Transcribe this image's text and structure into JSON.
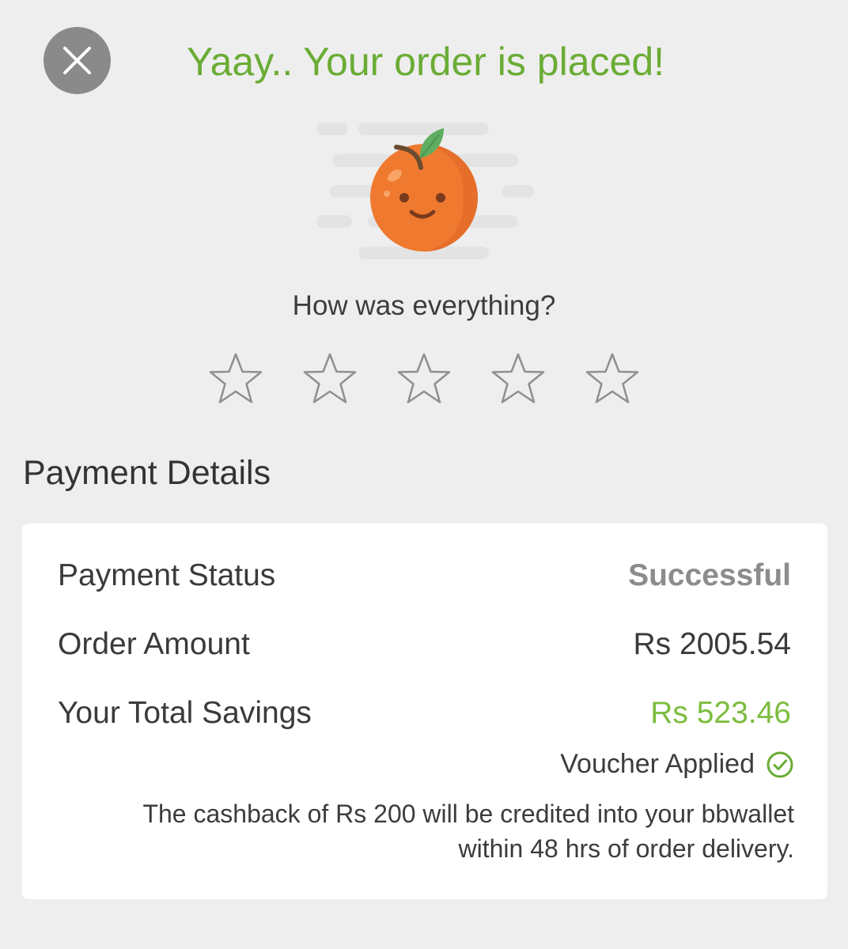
{
  "header": {
    "title": "Yaay.. Your order is placed!"
  },
  "icons": {
    "close": "close-icon",
    "mascot": "orange-mascot-illustration",
    "star": "star-outline-icon",
    "voucher_check": "check-circle-icon"
  },
  "rating": {
    "question": "How was everything?",
    "value": 0,
    "max": 5
  },
  "payment": {
    "heading": "Payment Details",
    "rows": [
      {
        "label": "Payment Status",
        "value": "Successful"
      },
      {
        "label": "Order Amount",
        "value": "Rs 2005.54"
      },
      {
        "label": "Your Total Savings",
        "value": "Rs 523.46"
      }
    ],
    "voucher_text": "Voucher Applied",
    "cashback_line1": "The cashback of Rs 200 will be credited into your bbwallet",
    "cashback_line2": "within 48 hrs of order delivery."
  },
  "colors": {
    "accent_green": "#6aac35",
    "savings_green": "#7cbd3f",
    "background": "#eeeeee",
    "card": "#ffffff",
    "orange": "#ef7a2f",
    "status_gray": "#8c8c8c"
  }
}
